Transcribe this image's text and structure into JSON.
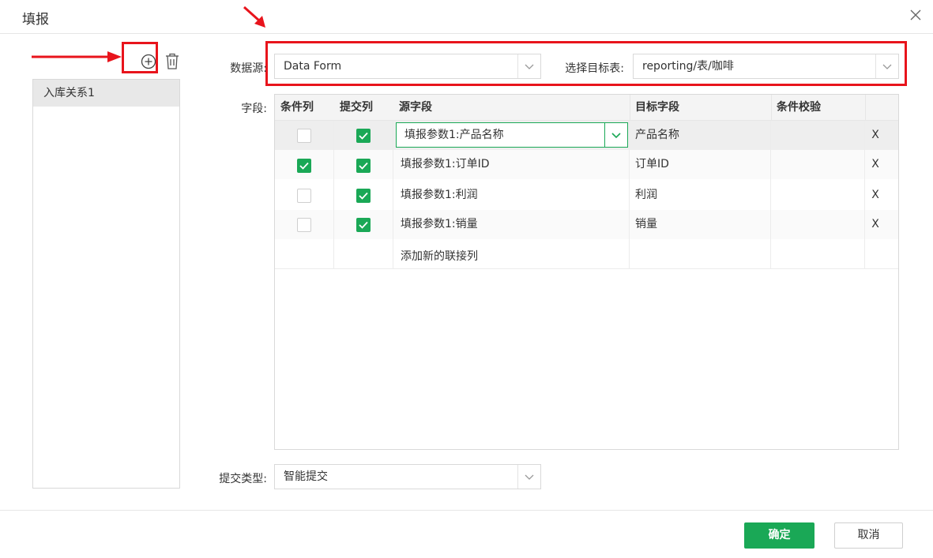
{
  "dialog": {
    "title": "填报"
  },
  "relations": {
    "items": [
      {
        "label": "入库关系1"
      }
    ]
  },
  "form": {
    "datasource_label": "数据源:",
    "datasource_value": "Data Form",
    "target_label": "选择目标表:",
    "target_value": "reporting/表/咖啡",
    "fields_label": "字段:",
    "submit_type_label": "提交类型:",
    "submit_type_value": "智能提交"
  },
  "table": {
    "headers": {
      "cond": "条件列",
      "submit": "提交列",
      "source": "源字段",
      "target": "目标字段",
      "validate": "条件校验"
    },
    "rows": [
      {
        "cond": false,
        "submit": true,
        "source": "填报参数1:产品名称",
        "target": "产品名称",
        "remove": "X",
        "editing": true
      },
      {
        "cond": true,
        "submit": true,
        "source": "填报参数1:订单ID",
        "target": "订单ID",
        "remove": "X"
      },
      {
        "cond": false,
        "submit": true,
        "source": "填报参数1:利润",
        "target": "利润",
        "remove": "X"
      },
      {
        "cond": false,
        "submit": true,
        "source": "填报参数1:销量",
        "target": "销量",
        "remove": "X"
      }
    ],
    "add_row_label": "添加新的联接列"
  },
  "footer": {
    "ok_label": "确定",
    "cancel_label": "取消"
  },
  "colors": {
    "accent": "#1aa856",
    "annotation": "#e8141c"
  }
}
